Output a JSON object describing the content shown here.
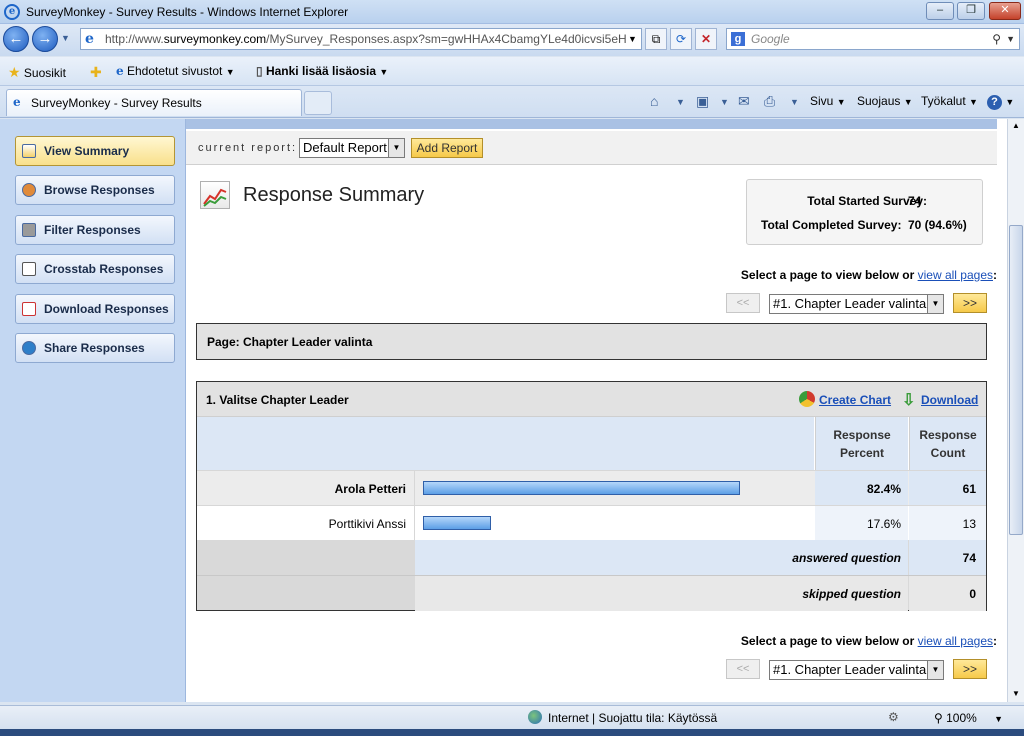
{
  "window": {
    "title": "SurveyMonkey - Survey Results - Windows Internet Explorer",
    "minimize": "–",
    "maximize": "❐",
    "close": "✕"
  },
  "address": {
    "url_prefix": "http://www.",
    "url_domain": "surveymonkey.com",
    "url_path": "/MySurvey_Responses.aspx?sm=gwHHAx4CbamgYLe4d0icvsi5eH",
    "search_placeholder": "Google"
  },
  "favorites": {
    "favorites_label": "Suosikit",
    "suggested_sites": "Ehdotetut sivustot",
    "get_more_addons": "Hanki lisää lisäosia"
  },
  "tab": {
    "label": "SurveyMonkey - Survey Results"
  },
  "commandbar": {
    "page": "Sivu",
    "safety": "Suojaus",
    "tools": "Työkalut"
  },
  "sidebar": {
    "items": [
      {
        "label": "View Summary",
        "icon": "chart-icon"
      },
      {
        "label": "Browse Responses",
        "icon": "people-icon"
      },
      {
        "label": "Filter Responses",
        "icon": "filter-icon"
      },
      {
        "label": "Crosstab Responses",
        "icon": "table-icon"
      },
      {
        "label": "Download Responses",
        "icon": "download-icon"
      },
      {
        "label": "Share Responses",
        "icon": "globe-icon"
      }
    ]
  },
  "report": {
    "label": "current report:",
    "selected": "Default Report",
    "add_button": "Add Report"
  },
  "summary": {
    "title": "Response Summary",
    "total_started_label": "Total Started Survey:",
    "total_started_value": "74",
    "total_completed_label": "Total Completed Survey:",
    "total_completed_value": "70  (94.6%)"
  },
  "pager": {
    "text": "Select a page to view below or",
    "link": "view all pages",
    "colon": ":",
    "prev": "<<",
    "next": ">>",
    "selected_page": "#1. Chapter Leader valinta"
  },
  "page_header": "Page: Chapter Leader valinta",
  "question": {
    "title": "1. Valitse Chapter Leader",
    "create_chart": "Create Chart",
    "download": "Download",
    "col_percent": "Response Percent",
    "col_count": "Response Count",
    "rows": [
      {
        "label": "Arola Petteri",
        "percent": "82.4%",
        "count": "61",
        "fraction": 0.824
      },
      {
        "label": "Porttikivi Anssi",
        "percent": "17.6%",
        "count": "13",
        "fraction": 0.176
      }
    ],
    "answered_label": "answered question",
    "answered_value": "74",
    "skipped_label": "skipped question",
    "skipped_value": "0"
  },
  "status": {
    "zone": "Internet | Suojattu tila: Käytössä",
    "zoom": "100%"
  }
}
